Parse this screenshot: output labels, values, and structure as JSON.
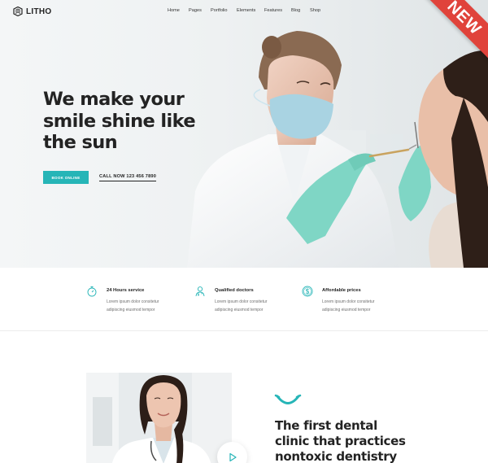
{
  "brand": {
    "logo_text": "LITHO",
    "accent_color": "#26b5b7",
    "ribbon_color": "#e0433b"
  },
  "nav": {
    "items": [
      "Home",
      "Pages",
      "Portfolio",
      "Elements",
      "Features",
      "Blog",
      "Shop"
    ]
  },
  "ribbon": {
    "label": "NEW"
  },
  "hero": {
    "title_lines": [
      "We make your",
      "smile shine like",
      "the sun"
    ],
    "book_button": "BOOK ONLINE",
    "call_link": "CALL NOW 123 456 7890"
  },
  "features": [
    {
      "icon": "stopwatch-icon",
      "title": "24 Hours service",
      "desc": "Lorem ipsum dolor consitetur adipiscing eiusmod tempor"
    },
    {
      "icon": "doctor-icon",
      "title": "Qualified doctors",
      "desc": "Lorem ipsum dolor consitetur adipiscing eiusmod tempor"
    },
    {
      "icon": "dollar-coin-icon",
      "title": "Affordable prices",
      "desc": "Lorem ipsum dolor consitetur adipiscing eiusmod tempor"
    }
  ],
  "about": {
    "title_lines": [
      "The first dental",
      "clinic that practices"
    ],
    "title_strong": "nontoxic dentistry"
  }
}
